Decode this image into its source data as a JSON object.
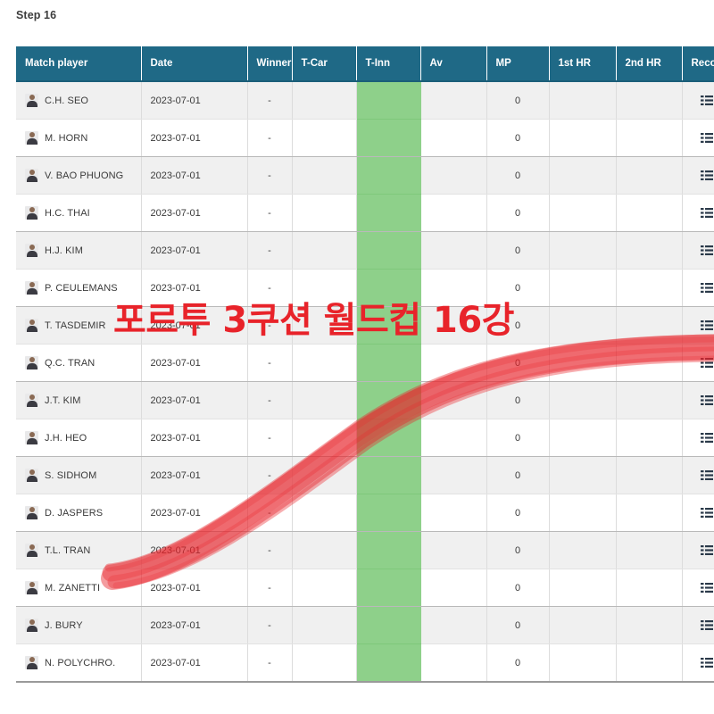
{
  "step_label": "Step 16",
  "annotation": {
    "title_text": "포르투 3쿠션 월드컵 16강",
    "title_color": "#e8232a",
    "stroke_color": "#e8232a",
    "stroke_shape": "s-curve-underline"
  },
  "theme": {
    "header_bg": "#1f6986",
    "header_text": "#ffffff",
    "row_odd_bg": "#f0f0f0",
    "row_even_bg": "#ffffff",
    "highlight_column_bg": "#8ed08a",
    "highlight_column": "T-Inn",
    "text_color": "#3a3a3a"
  },
  "table": {
    "columns": [
      {
        "key": "player",
        "label": "Match player"
      },
      {
        "key": "date",
        "label": "Date"
      },
      {
        "key": "winner",
        "label": "Winner"
      },
      {
        "key": "tcar",
        "label": "T-Car"
      },
      {
        "key": "tinn",
        "label": "T-Inn"
      },
      {
        "key": "av",
        "label": "Av"
      },
      {
        "key": "mp",
        "label": "MP"
      },
      {
        "key": "hr1",
        "label": "1st HR"
      },
      {
        "key": "hr2",
        "label": "2nd HR"
      },
      {
        "key": "record",
        "label": "Record"
      }
    ],
    "record_icon": "list-grid-icon",
    "avatar_icon": "player-avatar",
    "rows": [
      {
        "player": "C.H. SEO",
        "date": "2023-07-01",
        "winner": "-",
        "tcar": "",
        "tinn": "",
        "av": "",
        "mp": "0",
        "hr1": "",
        "hr2": ""
      },
      {
        "player": "M. HORN",
        "date": "2023-07-01",
        "winner": "-",
        "tcar": "",
        "tinn": "",
        "av": "",
        "mp": "0",
        "hr1": "",
        "hr2": ""
      },
      {
        "player": "V. BAO PHUONG",
        "date": "2023-07-01",
        "winner": "-",
        "tcar": "",
        "tinn": "",
        "av": "",
        "mp": "0",
        "hr1": "",
        "hr2": ""
      },
      {
        "player": "H.C. THAI",
        "date": "2023-07-01",
        "winner": "-",
        "tcar": "",
        "tinn": "",
        "av": "",
        "mp": "0",
        "hr1": "",
        "hr2": ""
      },
      {
        "player": "H.J. KIM",
        "date": "2023-07-01",
        "winner": "-",
        "tcar": "",
        "tinn": "",
        "av": "",
        "mp": "0",
        "hr1": "",
        "hr2": ""
      },
      {
        "player": "P. CEULEMANS",
        "date": "2023-07-01",
        "winner": "-",
        "tcar": "",
        "tinn": "",
        "av": "",
        "mp": "0",
        "hr1": "",
        "hr2": ""
      },
      {
        "player": "T. TASDEMIR",
        "date": "2023-07-01",
        "winner": "-",
        "tcar": "",
        "tinn": "",
        "av": "",
        "mp": "0",
        "hr1": "",
        "hr2": ""
      },
      {
        "player": "Q.C. TRAN",
        "date": "2023-07-01",
        "winner": "-",
        "tcar": "",
        "tinn": "",
        "av": "",
        "mp": "0",
        "hr1": "",
        "hr2": ""
      },
      {
        "player": "J.T. KIM",
        "date": "2023-07-01",
        "winner": "-",
        "tcar": "",
        "tinn": "",
        "av": "",
        "mp": "0",
        "hr1": "",
        "hr2": ""
      },
      {
        "player": "J.H. HEO",
        "date": "2023-07-01",
        "winner": "-",
        "tcar": "",
        "tinn": "",
        "av": "",
        "mp": "0",
        "hr1": "",
        "hr2": ""
      },
      {
        "player": "S. SIDHOM",
        "date": "2023-07-01",
        "winner": "-",
        "tcar": "",
        "tinn": "",
        "av": "",
        "mp": "0",
        "hr1": "",
        "hr2": ""
      },
      {
        "player": "D. JASPERS",
        "date": "2023-07-01",
        "winner": "-",
        "tcar": "",
        "tinn": "",
        "av": "",
        "mp": "0",
        "hr1": "",
        "hr2": ""
      },
      {
        "player": "T.L. TRAN",
        "date": "2023-07-01",
        "winner": "-",
        "tcar": "",
        "tinn": "",
        "av": "",
        "mp": "0",
        "hr1": "",
        "hr2": ""
      },
      {
        "player": "M. ZANETTI",
        "date": "2023-07-01",
        "winner": "-",
        "tcar": "",
        "tinn": "",
        "av": "",
        "mp": "0",
        "hr1": "",
        "hr2": ""
      },
      {
        "player": "J. BURY",
        "date": "2023-07-01",
        "winner": "-",
        "tcar": "",
        "tinn": "",
        "av": "",
        "mp": "0",
        "hr1": "",
        "hr2": ""
      },
      {
        "player": "N. POLYCHRO.",
        "date": "2023-07-01",
        "winner": "-",
        "tcar": "",
        "tinn": "",
        "av": "",
        "mp": "0",
        "hr1": "",
        "hr2": ""
      }
    ]
  }
}
